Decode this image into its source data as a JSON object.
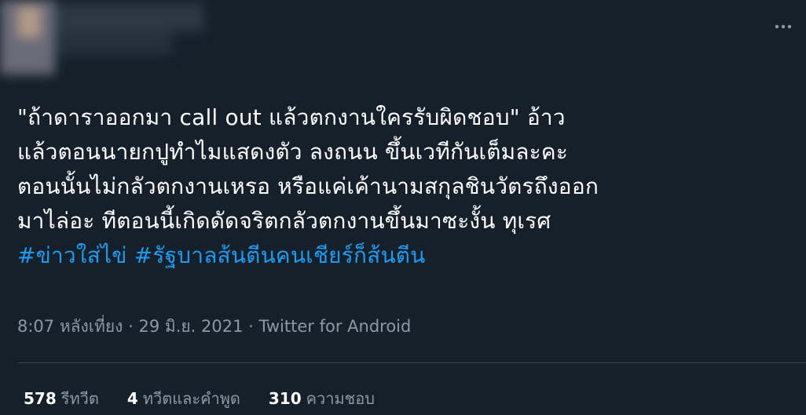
{
  "tweet": {
    "lines": [
      {
        "text": "\"ถ้าดาราออกมา call out  แล้วตกงานใครรับผิดชอบ\" อ้าว"
      },
      {
        "text": "แล้วตอนนายกปูทำไมแสดงตัว ลงถนน ขึ้นเวทีกันเต็มละคะ"
      },
      {
        "text": "ตอนนั้นไม่กลัวตกงานเหรอ หรือแค่เค้านามสกุลชินวัตรถึงออก"
      },
      {
        "text": "มาไล่อะ ทีตอนนี้เกิดดัดจริตกลัวตกงานขึ้นมาซะงั้น ทุเรศ"
      }
    ],
    "hashtags": [
      "#ข่าวใส่ไข่",
      "#รัฐบาลส้นตีนคนเชียร์ก็ส้นตีน"
    ]
  },
  "meta": {
    "time": "8:07 หลังเที่ยง",
    "date": "29 มิ.ย. 2021",
    "separator": "·",
    "source": "Twitter for Android"
  },
  "stats": {
    "retweets": {
      "count": "578",
      "label": "รีทวีต"
    },
    "quotes": {
      "count": "4",
      "label": "ทวีตและคำพูด"
    },
    "likes": {
      "count": "310",
      "label": "ความชอบ"
    }
  },
  "more_icon": "more-horizontal-icon",
  "colors": {
    "background": "#15202b",
    "text": "#ffffff",
    "muted": "#8b98a5",
    "link": "#1d9bf0",
    "divider": "#38444d"
  }
}
